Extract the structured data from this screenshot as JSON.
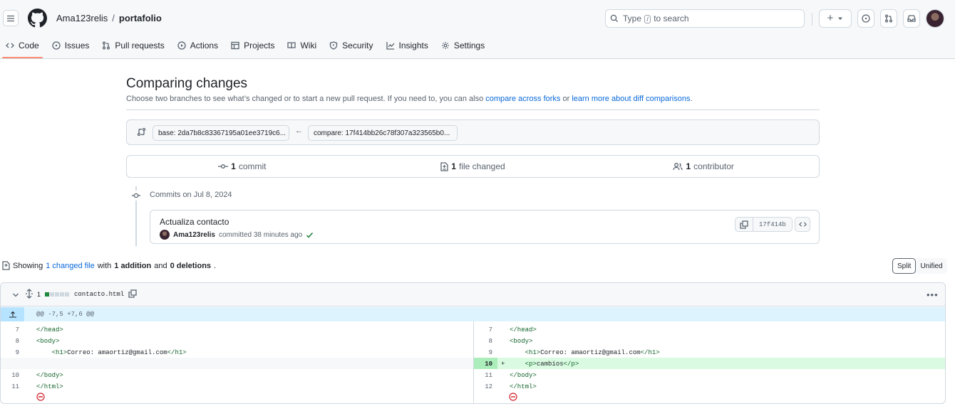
{
  "header": {
    "owner": "Ama123relis",
    "separator": "/",
    "repo": "portafolio",
    "search_text_before": "Type",
    "search_key": "/",
    "search_text_after": "to search",
    "plus_label": "+"
  },
  "nav": {
    "tabs": [
      {
        "label": "Code",
        "icon": "code-icon"
      },
      {
        "label": "Issues",
        "icon": "issue-icon"
      },
      {
        "label": "Pull requests",
        "icon": "pull-request-icon"
      },
      {
        "label": "Actions",
        "icon": "play-icon"
      },
      {
        "label": "Projects",
        "icon": "table-icon"
      },
      {
        "label": "Wiki",
        "icon": "book-icon"
      },
      {
        "label": "Security",
        "icon": "shield-icon"
      },
      {
        "label": "Insights",
        "icon": "graph-icon"
      },
      {
        "label": "Settings",
        "icon": "gear-icon"
      }
    ],
    "active_tab": "Code"
  },
  "compare": {
    "title": "Comparing changes",
    "subtitle_prefix": "Choose two branches to see what’s changed or to start a new pull request. If you need to, you can also",
    "link_forks": "compare across forks",
    "subtitle_or": "or",
    "link_learn": "learn more about diff comparisons",
    "subtitle_end": ".",
    "base_label": "base: 2da7b8c83367195a01ee3719c6...",
    "compare_label": "compare: 17f414bb26c78f307a323565b0...",
    "arrow": "←"
  },
  "stats": {
    "commits_count": "1",
    "commits_label": "commit",
    "files_count": "1",
    "files_label": "file changed",
    "contrib_count": "1",
    "contrib_label": "contributor"
  },
  "commits": {
    "date_heading": "Commits on Jul 8, 2024",
    "items": [
      {
        "title": "Actualiza contacto",
        "author": "Ama123relis",
        "action": "committed 38 minutes ago",
        "sha": "17f414b"
      }
    ]
  },
  "summary": {
    "prefix": "Showing",
    "files_link": "1 changed file",
    "with": "with",
    "additions": "1 addition",
    "and": "and",
    "deletions": "0 deletions",
    "end": ".",
    "split_label": "Split",
    "unified_label": "Unified",
    "active_view": "Split"
  },
  "file": {
    "changes_count": "1",
    "diffstat": {
      "added": 1,
      "neutral": 4
    },
    "name": "contacto.html",
    "hunk_header": "@@ -7,5 +7,6 @@",
    "left": [
      {
        "ln": "7",
        "code": "</head>"
      },
      {
        "ln": "8",
        "code": "<body>"
      },
      {
        "ln": "9",
        "code": "    <h1>Correo: amaortiz@gmail.com</h1>"
      },
      {
        "ln": "",
        "code": ""
      },
      {
        "ln": "10",
        "code": "</body>"
      },
      {
        "ln": "11",
        "code": "</html>"
      }
    ],
    "right": [
      {
        "ln": "7",
        "code": "</head>",
        "type": "ctx"
      },
      {
        "ln": "8",
        "code": "<body>",
        "type": "ctx"
      },
      {
        "ln": "9",
        "code": "    <h1>Correo: amaortiz@gmail.com</h1>",
        "type": "ctx"
      },
      {
        "ln": "10",
        "code": "    <p>cambios</p>",
        "type": "add",
        "sign": "+"
      },
      {
        "ln": "11",
        "code": "</body>",
        "type": "ctx"
      },
      {
        "ln": "12",
        "code": "</html>",
        "type": "ctx"
      }
    ]
  },
  "colors": {
    "link": "#0969da",
    "added_bg": "#dafbe1",
    "added_gutter": "#aceebb",
    "hunk_bg": "#ddf4ff",
    "active_tab_underline": "#fd8c73",
    "success_check": "#1a7f37",
    "no_eol": "#cf222e"
  }
}
